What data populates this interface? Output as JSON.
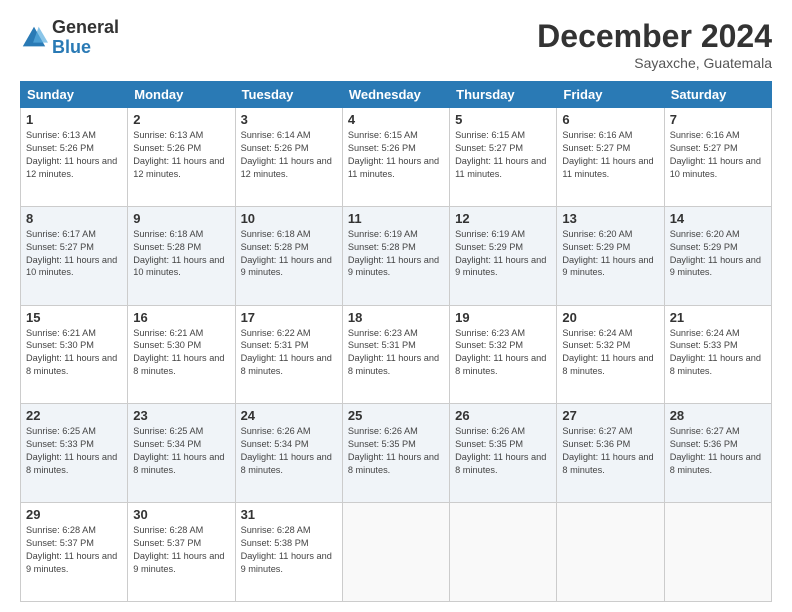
{
  "logo": {
    "general": "General",
    "blue": "Blue"
  },
  "title": "December 2024",
  "location": "Sayaxche, Guatemala",
  "days_header": [
    "Sunday",
    "Monday",
    "Tuesday",
    "Wednesday",
    "Thursday",
    "Friday",
    "Saturday"
  ],
  "weeks": [
    [
      {
        "day": "1",
        "sunrise": "6:13 AM",
        "sunset": "5:26 PM",
        "daylight": "11 hours and 12 minutes."
      },
      {
        "day": "2",
        "sunrise": "6:13 AM",
        "sunset": "5:26 PM",
        "daylight": "11 hours and 12 minutes."
      },
      {
        "day": "3",
        "sunrise": "6:14 AM",
        "sunset": "5:26 PM",
        "daylight": "11 hours and 12 minutes."
      },
      {
        "day": "4",
        "sunrise": "6:15 AM",
        "sunset": "5:26 PM",
        "daylight": "11 hours and 11 minutes."
      },
      {
        "day": "5",
        "sunrise": "6:15 AM",
        "sunset": "5:27 PM",
        "daylight": "11 hours and 11 minutes."
      },
      {
        "day": "6",
        "sunrise": "6:16 AM",
        "sunset": "5:27 PM",
        "daylight": "11 hours and 11 minutes."
      },
      {
        "day": "7",
        "sunrise": "6:16 AM",
        "sunset": "5:27 PM",
        "daylight": "11 hours and 10 minutes."
      }
    ],
    [
      {
        "day": "8",
        "sunrise": "6:17 AM",
        "sunset": "5:27 PM",
        "daylight": "11 hours and 10 minutes."
      },
      {
        "day": "9",
        "sunrise": "6:18 AM",
        "sunset": "5:28 PM",
        "daylight": "11 hours and 10 minutes."
      },
      {
        "day": "10",
        "sunrise": "6:18 AM",
        "sunset": "5:28 PM",
        "daylight": "11 hours and 9 minutes."
      },
      {
        "day": "11",
        "sunrise": "6:19 AM",
        "sunset": "5:28 PM",
        "daylight": "11 hours and 9 minutes."
      },
      {
        "day": "12",
        "sunrise": "6:19 AM",
        "sunset": "5:29 PM",
        "daylight": "11 hours and 9 minutes."
      },
      {
        "day": "13",
        "sunrise": "6:20 AM",
        "sunset": "5:29 PM",
        "daylight": "11 hours and 9 minutes."
      },
      {
        "day": "14",
        "sunrise": "6:20 AM",
        "sunset": "5:29 PM",
        "daylight": "11 hours and 9 minutes."
      }
    ],
    [
      {
        "day": "15",
        "sunrise": "6:21 AM",
        "sunset": "5:30 PM",
        "daylight": "11 hours and 8 minutes."
      },
      {
        "day": "16",
        "sunrise": "6:21 AM",
        "sunset": "5:30 PM",
        "daylight": "11 hours and 8 minutes."
      },
      {
        "day": "17",
        "sunrise": "6:22 AM",
        "sunset": "5:31 PM",
        "daylight": "11 hours and 8 minutes."
      },
      {
        "day": "18",
        "sunrise": "6:23 AM",
        "sunset": "5:31 PM",
        "daylight": "11 hours and 8 minutes."
      },
      {
        "day": "19",
        "sunrise": "6:23 AM",
        "sunset": "5:32 PM",
        "daylight": "11 hours and 8 minutes."
      },
      {
        "day": "20",
        "sunrise": "6:24 AM",
        "sunset": "5:32 PM",
        "daylight": "11 hours and 8 minutes."
      },
      {
        "day": "21",
        "sunrise": "6:24 AM",
        "sunset": "5:33 PM",
        "daylight": "11 hours and 8 minutes."
      }
    ],
    [
      {
        "day": "22",
        "sunrise": "6:25 AM",
        "sunset": "5:33 PM",
        "daylight": "11 hours and 8 minutes."
      },
      {
        "day": "23",
        "sunrise": "6:25 AM",
        "sunset": "5:34 PM",
        "daylight": "11 hours and 8 minutes."
      },
      {
        "day": "24",
        "sunrise": "6:26 AM",
        "sunset": "5:34 PM",
        "daylight": "11 hours and 8 minutes."
      },
      {
        "day": "25",
        "sunrise": "6:26 AM",
        "sunset": "5:35 PM",
        "daylight": "11 hours and 8 minutes."
      },
      {
        "day": "26",
        "sunrise": "6:26 AM",
        "sunset": "5:35 PM",
        "daylight": "11 hours and 8 minutes."
      },
      {
        "day": "27",
        "sunrise": "6:27 AM",
        "sunset": "5:36 PM",
        "daylight": "11 hours and 8 minutes."
      },
      {
        "day": "28",
        "sunrise": "6:27 AM",
        "sunset": "5:36 PM",
        "daylight": "11 hours and 8 minutes."
      }
    ],
    [
      {
        "day": "29",
        "sunrise": "6:28 AM",
        "sunset": "5:37 PM",
        "daylight": "11 hours and 9 minutes."
      },
      {
        "day": "30",
        "sunrise": "6:28 AM",
        "sunset": "5:37 PM",
        "daylight": "11 hours and 9 minutes."
      },
      {
        "day": "31",
        "sunrise": "6:28 AM",
        "sunset": "5:38 PM",
        "daylight": "11 hours and 9 minutes."
      },
      null,
      null,
      null,
      null
    ]
  ]
}
